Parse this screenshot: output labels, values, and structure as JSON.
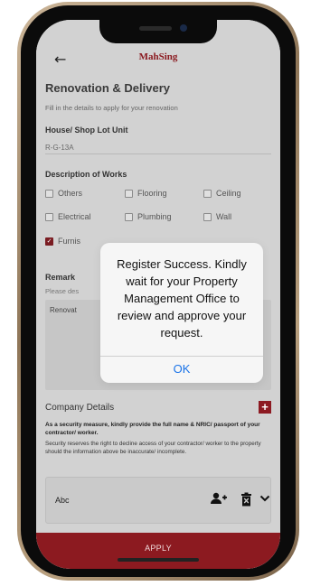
{
  "header": {
    "back_icon": "←",
    "logo_text": "MahSing"
  },
  "form": {
    "title": "Renovation & Delivery",
    "subtitle": "Fill in the details to apply for your renovation",
    "house_label": "House/ Shop Lot Unit",
    "house_value": "R-G-13A",
    "works_label": "Description of Works",
    "works": [
      {
        "label": "Others",
        "checked": false
      },
      {
        "label": "Flooring",
        "checked": false
      },
      {
        "label": "Ceiling",
        "checked": false
      },
      {
        "label": "Electrical",
        "checked": false
      },
      {
        "label": "Plumbing",
        "checked": false
      },
      {
        "label": "Wall",
        "checked": false
      },
      {
        "label": "Furnis",
        "checked": true
      }
    ],
    "remark_label": "Remark",
    "remark_hint_left": "Please des",
    "remark_hint_right": "hers",
    "remark_value": "Renovat"
  },
  "company": {
    "title": "Company Details",
    "add_label": "+",
    "security_bold": "As a security measure, kindly provide the full name & NRIC/ passport of your contractor/ worker.",
    "security_note": "Security reserves the right to decline access of your contractor/ worker to the property should the information above be inaccurate/ incomplete.",
    "contractor_name": "Abc"
  },
  "footer": {
    "apply_label": "APPLY"
  },
  "alert": {
    "message": "Register Success. Kindly wait for your Property Management Office to review and approve your request.",
    "ok_label": "OK"
  },
  "icons": {
    "add_person": "add-person-icon",
    "delete": "delete-icon",
    "chevron": "chevron-down-icon"
  },
  "colors": {
    "brand": "#8c1a20",
    "link": "#1a73e8"
  }
}
